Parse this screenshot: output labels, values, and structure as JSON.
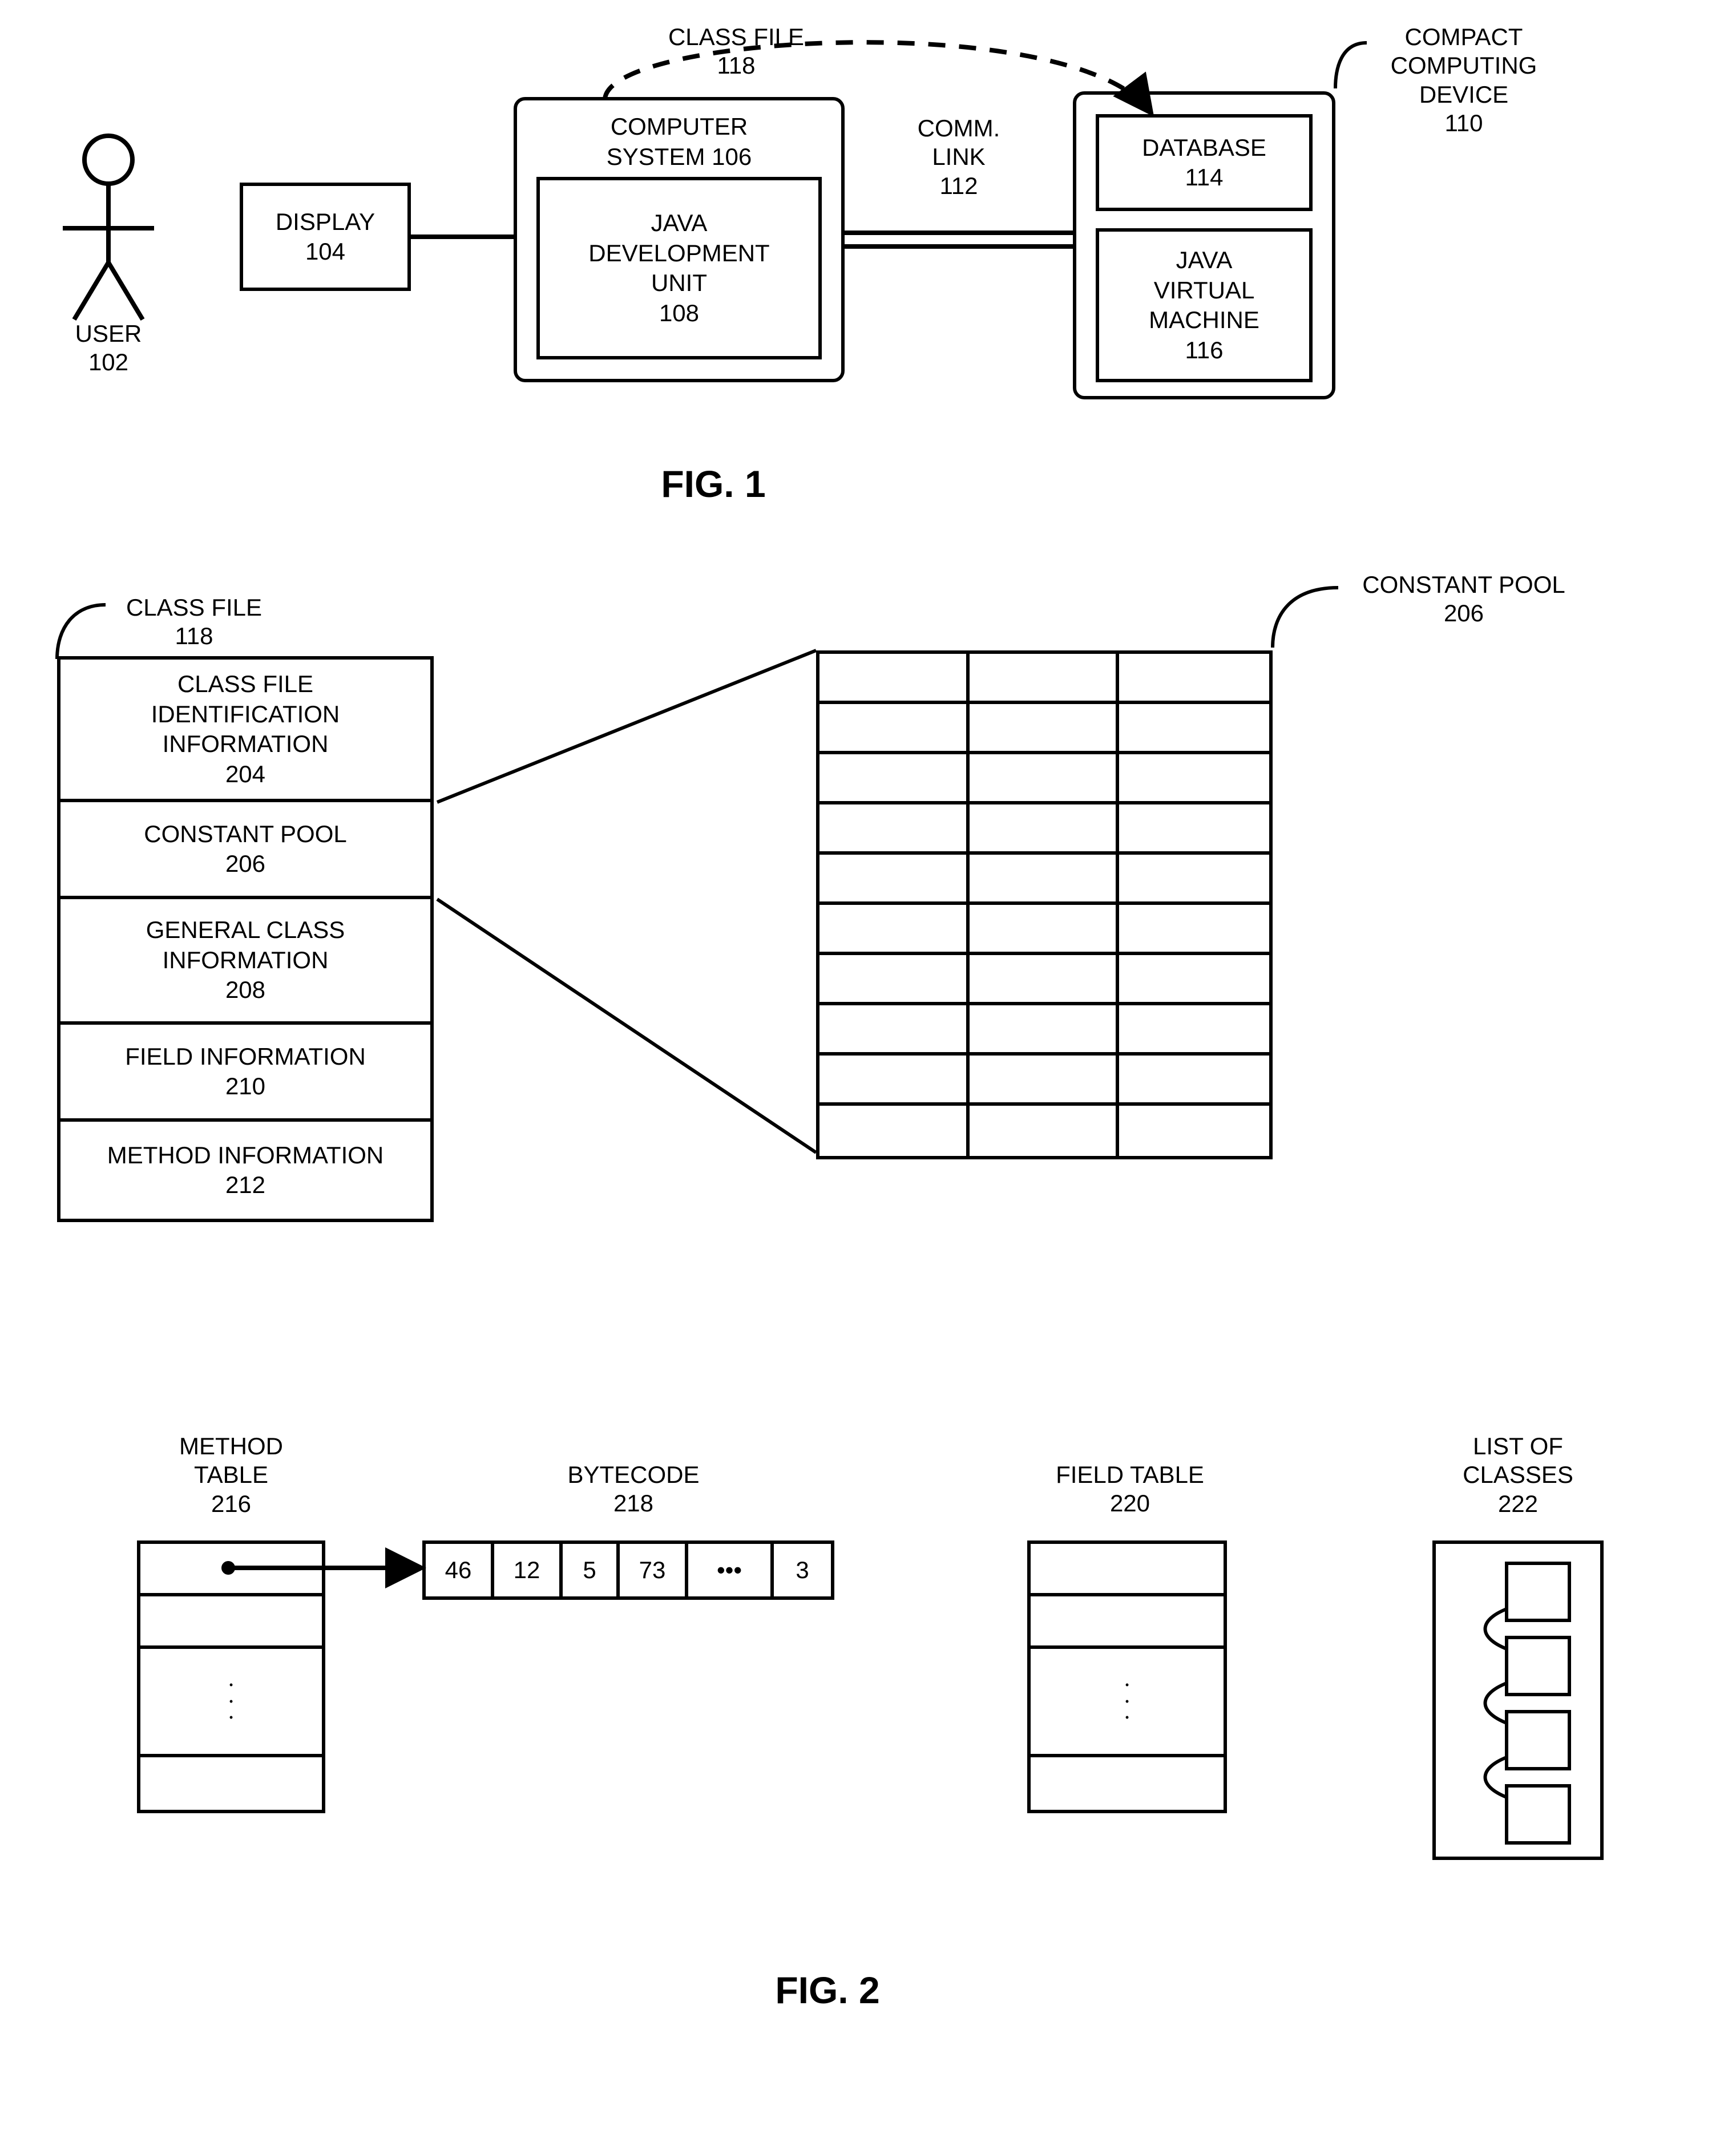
{
  "fig1": {
    "title": "FIG. 1",
    "user": {
      "label": "USER",
      "num": "102"
    },
    "display": {
      "label": "DISPLAY",
      "num": "104"
    },
    "computer_system": {
      "label": "COMPUTER",
      "label2": "SYSTEM 106"
    },
    "jdu": {
      "l1": "JAVA",
      "l2": "DEVELOPMENT",
      "l3": "UNIT",
      "num": "108"
    },
    "commlink": {
      "l1": "COMM.",
      "l2": "LINK",
      "num": "112"
    },
    "classfile": {
      "l1": "CLASS FILE",
      "num": "118"
    },
    "device": {
      "l1": "COMPACT",
      "l2": "COMPUTING",
      "l3": "DEVICE",
      "num": "110"
    },
    "database": {
      "label": "DATABASE",
      "num": "114"
    },
    "jvm": {
      "l1": "JAVA",
      "l2": "VIRTUAL",
      "l3": "MACHINE",
      "num": "116"
    }
  },
  "fig2": {
    "title": "FIG. 2",
    "classfile_header": {
      "label": "CLASS FILE",
      "num": "118"
    },
    "constantpool_header": {
      "label": "CONSTANT POOL",
      "num": "206"
    },
    "stack": [
      {
        "l1": "CLASS FILE",
        "l2": "IDENTIFICATION",
        "l3": "INFORMATION",
        "num": "204"
      },
      {
        "l1": "CONSTANT POOL",
        "num": "206"
      },
      {
        "l1": "GENERAL CLASS",
        "l2": "INFORMATION",
        "num": "208"
      },
      {
        "l1": "FIELD INFORMATION",
        "num": "210"
      },
      {
        "l1": "METHOD INFORMATION",
        "num": "212"
      }
    ],
    "method_table": {
      "l1": "METHOD",
      "l2": "TABLE",
      "num": "216"
    },
    "bytecode": {
      "label": "BYTECODE",
      "num": "218",
      "cells": [
        "46",
        "12",
        "5",
        "73",
        "•••",
        "3"
      ]
    },
    "field_table": {
      "label": "FIELD TABLE",
      "num": "220"
    },
    "list_of_classes": {
      "l1": "LIST OF",
      "l2": "CLASSES",
      "num": "222"
    }
  }
}
